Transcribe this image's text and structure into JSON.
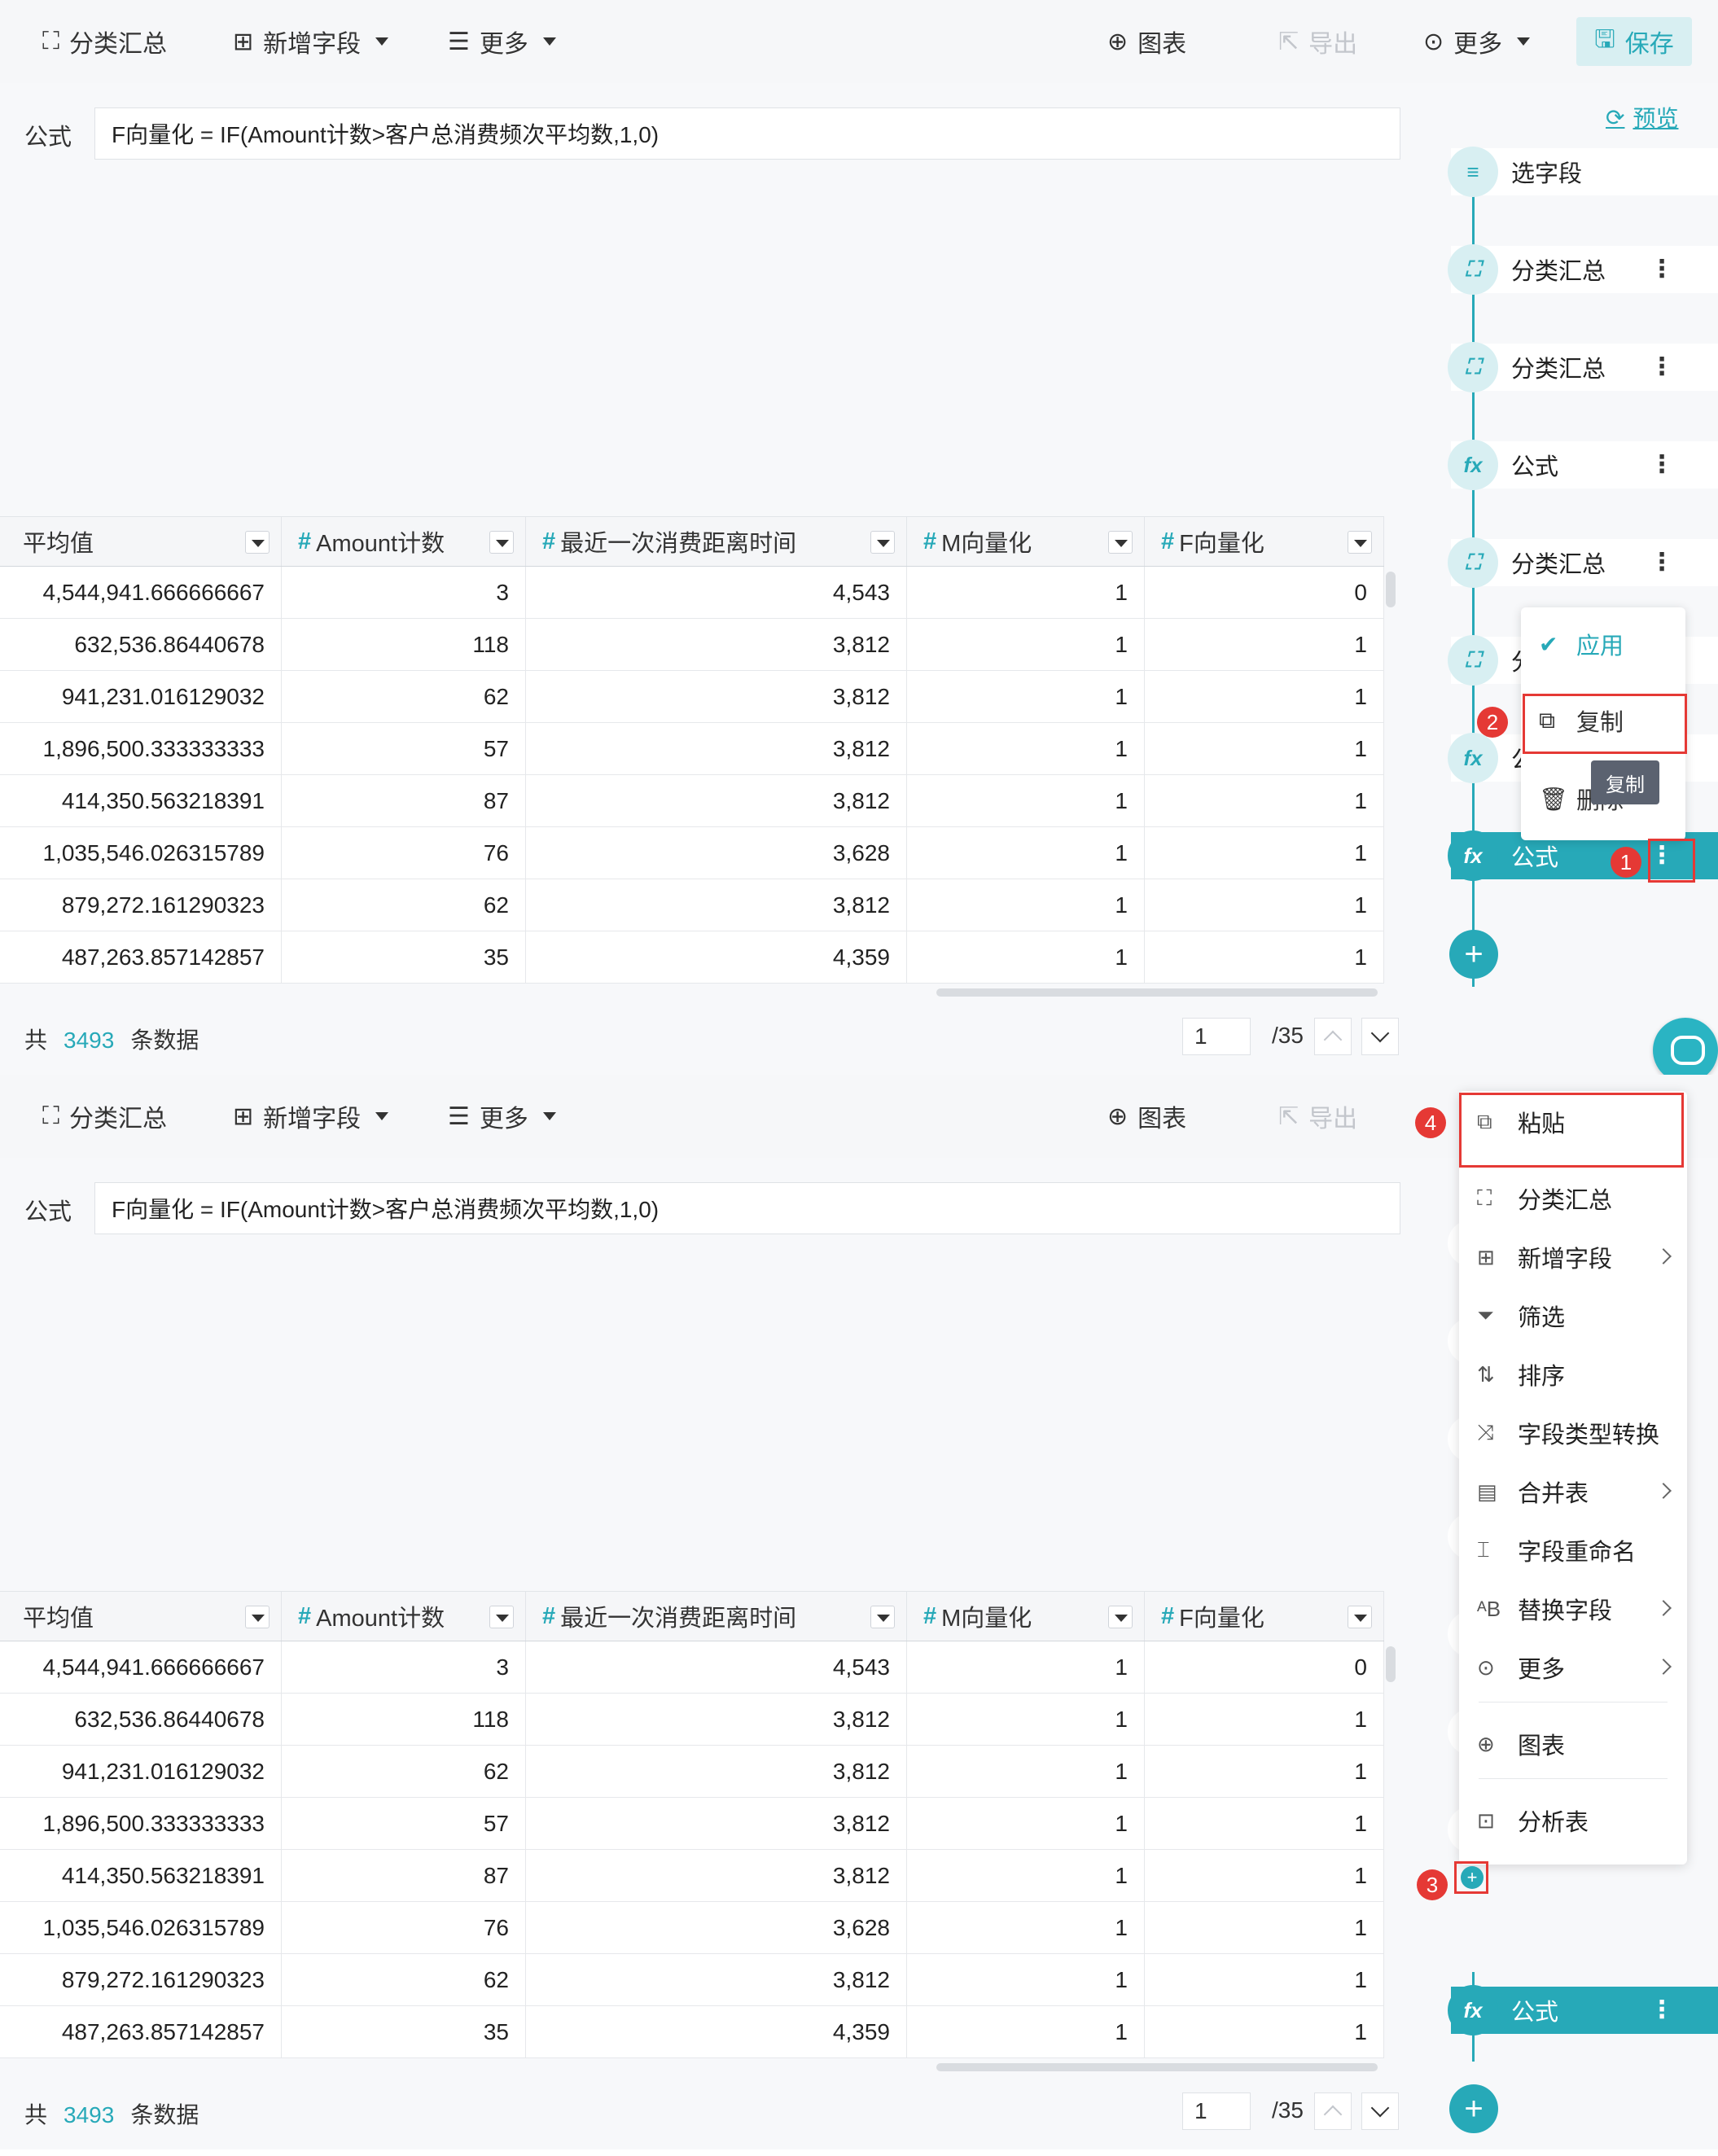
{
  "toolbar": {
    "group_summary": "分类汇总",
    "add_field": "新增字段",
    "more": "更多",
    "chart": "图表",
    "export": "导出",
    "more_right": "更多",
    "save": "保存"
  },
  "formula": {
    "label": "公式",
    "value": "F向量化 = IF(Amount计数>客户总消费频次平均数,1,0)"
  },
  "table": {
    "headers": [
      "平均值",
      "Amount计数",
      "最近一次消费距离时间",
      "M向量化",
      "F向量化"
    ],
    "rows": [
      [
        "4,544,941.666666667",
        "3",
        "4,543",
        "1",
        "0"
      ],
      [
        "632,536.86440678",
        "118",
        "3,812",
        "1",
        "1"
      ],
      [
        "941,231.016129032",
        "62",
        "3,812",
        "1",
        "1"
      ],
      [
        "1,896,500.333333333",
        "57",
        "3,812",
        "1",
        "1"
      ],
      [
        "414,350.563218391",
        "87",
        "3,812",
        "1",
        "1"
      ],
      [
        "1,035,546.026315789",
        "76",
        "3,628",
        "1",
        "1"
      ],
      [
        "879,272.161290323",
        "62",
        "3,812",
        "1",
        "1"
      ],
      [
        "487,263.857142857",
        "35",
        "4,359",
        "1",
        "1"
      ]
    ]
  },
  "footer": {
    "prefix": "共",
    "count": "3493",
    "suffix": "条数据",
    "page": "1",
    "total_pages": "/35"
  },
  "sidebar": {
    "preview": "预览",
    "steps": [
      {
        "label": "选字段",
        "icon": "select-fields-icon"
      },
      {
        "label": "分类汇总",
        "icon": "group-summary-icon"
      },
      {
        "label": "分类汇总",
        "icon": "group-summary-icon"
      },
      {
        "label": "公式",
        "icon": "formula-icon"
      },
      {
        "label": "分类汇总",
        "icon": "group-summary-icon"
      },
      {
        "label": "分",
        "icon": "group-summary-icon"
      },
      {
        "label": "公",
        "icon": "formula-icon"
      },
      {
        "label": "公式",
        "icon": "formula-icon"
      }
    ],
    "bottom_step": "公式"
  },
  "context_menu": {
    "apply": "应用",
    "copy": "复制",
    "delete": "删除",
    "tooltip": "复制"
  },
  "add_menu": {
    "items": [
      {
        "label": "粘贴",
        "icon": "paste-icon"
      },
      {
        "label": "分类汇总",
        "icon": "group-summary-icon"
      },
      {
        "label": "新增字段",
        "icon": "add-field-icon",
        "submenu": true
      },
      {
        "label": "筛选",
        "icon": "filter-icon"
      },
      {
        "label": "排序",
        "icon": "sort-icon"
      },
      {
        "label": "字段类型转换",
        "icon": "type-convert-icon"
      },
      {
        "label": "合并表",
        "icon": "merge-table-icon",
        "submenu": true
      },
      {
        "label": "字段重命名",
        "icon": "rename-icon"
      },
      {
        "label": "替换字段",
        "icon": "replace-field-icon",
        "submenu": true
      },
      {
        "label": "更多",
        "icon": "more-icon",
        "submenu": true
      },
      {
        "label": "图表",
        "icon": "chart-icon"
      },
      {
        "label": "分析表",
        "icon": "analysis-table-icon"
      }
    ]
  },
  "annotations": [
    "1",
    "2",
    "3",
    "4"
  ],
  "colors": {
    "accent": "#27a9b8",
    "annotation": "#e53935"
  }
}
